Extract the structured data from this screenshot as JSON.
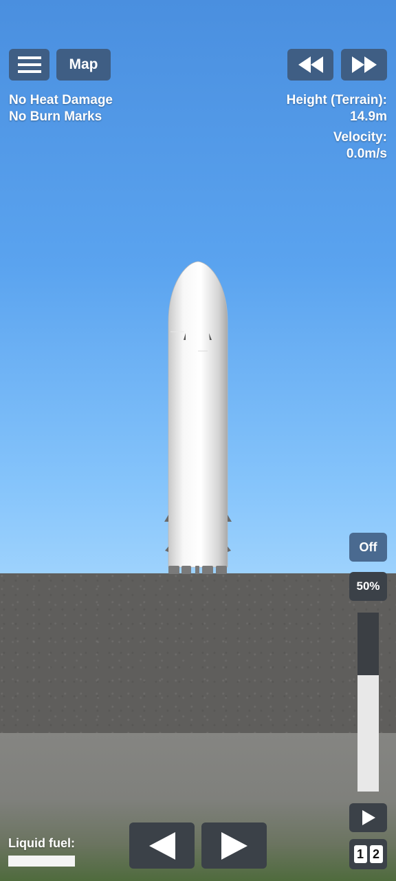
{
  "hud": {
    "menu_icon": "hamburger-icon",
    "map_label": "Map",
    "rewind_icon": "rewind-icon",
    "fast_forward_icon": "fast-forward-icon",
    "status_lines": [
      "No Heat Damage",
      "No Burn Marks"
    ],
    "height_label": "Height (Terrain):",
    "height_value": "14.9m",
    "velocity_label": "Velocity:",
    "velocity_value": "0.0m/s"
  },
  "controls": {
    "engine_toggle": "Off",
    "throttle_percent_label": "50%",
    "throttle_level": 0.65,
    "play_icon": "play-icon",
    "stage_digits": [
      "1",
      "2"
    ],
    "rotate_left_icon": "triangle-left-icon",
    "rotate_right_icon": "triangle-right-icon"
  },
  "fuel": {
    "label": "Liquid fuel:",
    "level": 1.0
  },
  "colors": {
    "sky_top": "#4a8fdf",
    "sky_bottom": "#9dd2fd",
    "ground": "#5f5e5c",
    "button_blue": "#3f5e84",
    "button_dark": "#3b4148"
  }
}
